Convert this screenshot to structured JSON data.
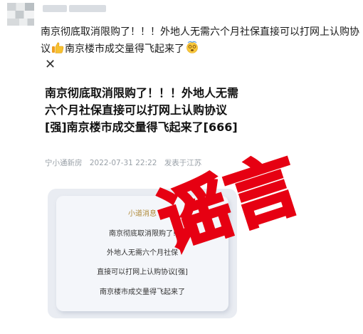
{
  "post": {
    "text_part1": "南京彻底取消限购了！！！外地人无需六个月社保直接可以打网上认购协议",
    "text_part2": "南京楼市成交量得飞起来了"
  },
  "card": {
    "close_glyph": "✕",
    "title": "南京彻底取消限购了！！！外地人无需六个月社保直接可以打网上认购协议[强]南京楼市成交量得飞起来了[666]",
    "source": "宁小通新房",
    "date": "2022-07-31 22:22",
    "published_label": "发表于江苏",
    "message": {
      "header": "小道消息",
      "lines": [
        "南京彻底取消限购了!",
        "外地人无需六个月社保",
        "直接可以打网上认购协议[强]",
        "南京楼市成交量得飞起来了"
      ]
    }
  },
  "stamp": {
    "text": "谣言",
    "color": "#e60012"
  }
}
